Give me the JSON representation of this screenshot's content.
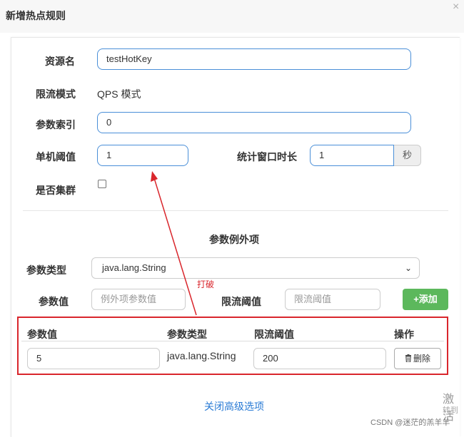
{
  "dialog": {
    "title": "新增热点规则",
    "close_label": "×"
  },
  "form": {
    "resource_label": "资源名",
    "resource_value": "testHotKey",
    "mode_label": "限流模式",
    "mode_value": "QPS 模式",
    "param_index_label": "参数索引",
    "param_index_value": "0",
    "threshold_label": "单机阈值",
    "threshold_value": "1",
    "window_label": "统计窗口时长",
    "window_value": "1",
    "window_unit": "秒",
    "cluster_label": "是否集群"
  },
  "exceptions": {
    "section_title": "参数例外项",
    "type_label": "参数类型",
    "type_selected": "java.lang.String",
    "value_label": "参数值",
    "value_placeholder": "例外项参数值",
    "limit_label": "限流阈值",
    "limit_placeholder": "限流阈值",
    "add_button": "+添加"
  },
  "table": {
    "headers": [
      "参数值",
      "参数类型",
      "限流阈值",
      "操作"
    ],
    "rows": [
      {
        "param_value": "5",
        "param_type": "java.lang.String",
        "limit": "200",
        "delete_label": "删除"
      }
    ]
  },
  "footer": {
    "advanced_link": "关闭高级选项"
  },
  "annotation": {
    "text": "打破",
    "color": "#d9262c"
  },
  "overlay": {
    "watermark_line1": "激活",
    "watermark_line2": "转到",
    "credit": "CSDN @迷茫的羔羊羊"
  },
  "colors": {
    "accent_blue": "#4a8fd8",
    "add_green": "#5cb85c",
    "highlight_red": "#d9262c",
    "link_blue": "#2a7bd5"
  },
  "icons": {
    "chevron": "chevron-down-icon",
    "trash": "trash-icon",
    "close": "close-icon"
  }
}
